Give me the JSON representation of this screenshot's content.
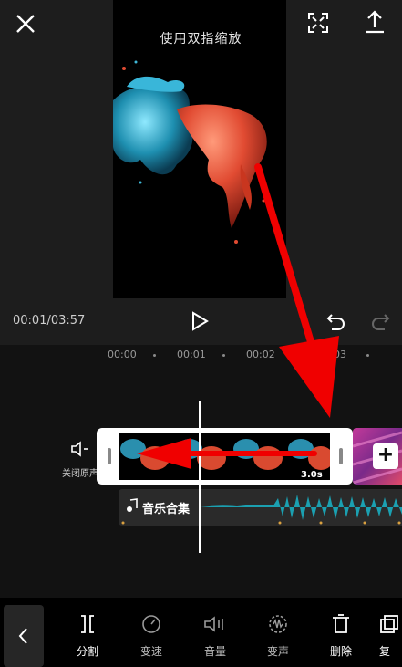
{
  "preview": {
    "hint": "使用双指缩放",
    "time": "00:01/03:57"
  },
  "timeline": {
    "ticks": [
      "00:00",
      "00:01",
      "00:02",
      "03"
    ],
    "mute_label": "关闭原声",
    "clip_duration": "3.0s",
    "add_label": "+",
    "audio_label": "音乐合集"
  },
  "toolbar": {
    "items": [
      {
        "label": "分割",
        "icon": "split-icon"
      },
      {
        "label": "变速",
        "icon": "speed-icon"
      },
      {
        "label": "音量",
        "icon": "volume-icon"
      },
      {
        "label": "变声",
        "icon": "voice-change-icon"
      },
      {
        "label": "删除",
        "icon": "delete-icon"
      },
      {
        "label": "复",
        "icon": "copy-icon"
      }
    ]
  },
  "colors": {
    "annotation_red": "#f00000",
    "audio_wave": "#1aa7b8"
  }
}
